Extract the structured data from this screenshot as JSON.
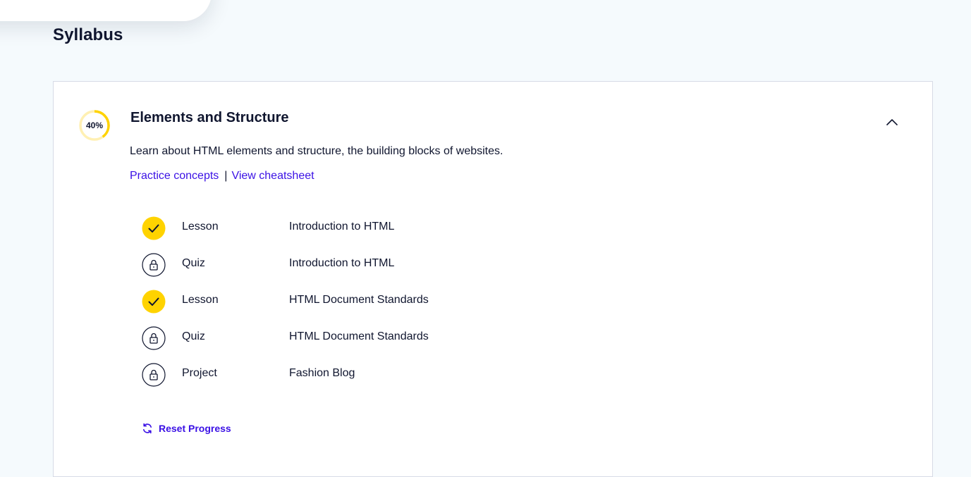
{
  "page": {
    "title": "Syllabus"
  },
  "module": {
    "progress_percent": 40,
    "progress_label": "40%",
    "title": "Elements and Structure",
    "description": "Learn about HTML elements and structure, the building blocks of websites.",
    "links": {
      "practice": "Practice concepts",
      "separator": "|",
      "cheatsheet": "View cheatsheet"
    },
    "collapse_icon": "chevron-up-icon",
    "items": [
      {
        "type": "Lesson",
        "name": "Introduction to HTML",
        "status": "completed",
        "icon": "check-icon"
      },
      {
        "type": "Quiz",
        "name": "Introduction to HTML",
        "status": "locked",
        "icon": "lock-icon"
      },
      {
        "type": "Lesson",
        "name": "HTML Document Standards",
        "status": "completed",
        "icon": "check-icon"
      },
      {
        "type": "Quiz",
        "name": "HTML Document Standards",
        "status": "locked",
        "icon": "lock-icon"
      },
      {
        "type": "Project",
        "name": "Fashion Blog",
        "status": "locked",
        "icon": "lock-icon"
      }
    ],
    "reset_label": "Reset Progress",
    "reset_icon": "refresh-icon"
  },
  "colors": {
    "background": "#f5fafd",
    "text": "#10162f",
    "link": "#3a10e5",
    "progress": "#ffd300",
    "progress_track": "#fff0b3",
    "card_border": "#d7dbe6"
  }
}
